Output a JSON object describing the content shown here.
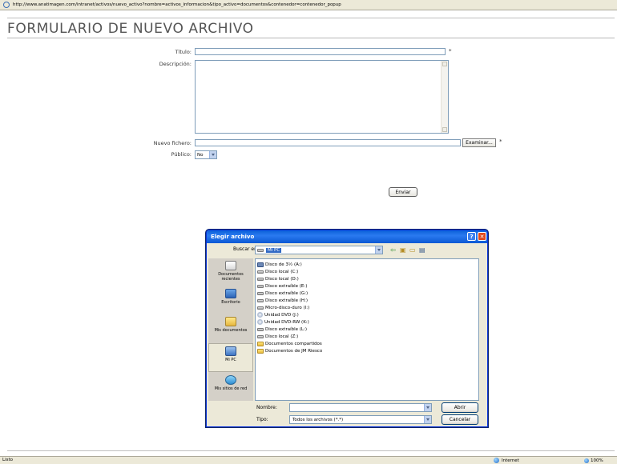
{
  "browser": {
    "url": "http://www.anatimagen.com/intranet/activos/nuevo_activo?nombre=activos_informacion&tipo_activo=documentos&contenedor=contenedor_popup",
    "status_text": "Listo",
    "zone": "Internet",
    "zoom": "100%"
  },
  "page": {
    "title": "FORMULARIO DE NUEVO ARCHIVO",
    "fields": {
      "titulo_label": "Título:",
      "titulo_value": "",
      "descripcion_label": "Descripción:",
      "descripcion_value": "",
      "fichero_label": "Nuevo fichero:",
      "fichero_value": "",
      "browse_label": "Examinar...",
      "publico_label": "Público:",
      "publico_value": "No",
      "required_mark": "*"
    },
    "submit_label": "Enviar"
  },
  "dialog": {
    "title": "Elegir archivo",
    "help_glyph": "?",
    "close_glyph": "✕",
    "look_in_label": "Buscar en:",
    "look_in_value": "Mi PC",
    "places": [
      {
        "label": "Documentos recientes",
        "icon": "recent-documents-icon"
      },
      {
        "label": "Escritorio",
        "icon": "desktop-icon"
      },
      {
        "label": "Mis documentos",
        "icon": "my-documents-icon"
      },
      {
        "label": "Mi PC",
        "icon": "my-computer-icon"
      },
      {
        "label": "Mis sitios de red",
        "icon": "network-places-icon"
      }
    ],
    "files": [
      {
        "name": "Disco de 3½ (A:)",
        "kind": "floppy"
      },
      {
        "name": "Disco local (C:)",
        "kind": "drive"
      },
      {
        "name": "Disco local (D:)",
        "kind": "drive"
      },
      {
        "name": "Disco extraíble (E:)",
        "kind": "drive"
      },
      {
        "name": "Disco extraíble (G:)",
        "kind": "drive"
      },
      {
        "name": "Disco extraíble (H:)",
        "kind": "drive"
      },
      {
        "name": "Micro-disco-duro (I:)",
        "kind": "drive"
      },
      {
        "name": "Unidad DVD (J:)",
        "kind": "cd"
      },
      {
        "name": "Unidad DVD-RW (K:)",
        "kind": "cd"
      },
      {
        "name": "Disco extraíble (L:)",
        "kind": "drive"
      },
      {
        "name": "Disco local (Z:)",
        "kind": "drive"
      },
      {
        "name": "Documentos compartidos",
        "kind": "folder"
      },
      {
        "name": "Documentos de JM Riesco",
        "kind": "folder"
      }
    ],
    "filename_label": "Nombre:",
    "filename_value": "",
    "filetype_label": "Tipo:",
    "filetype_value": "Todos los archivos (*.*)",
    "open_label": "Abrir",
    "cancel_label": "Cancelar"
  }
}
